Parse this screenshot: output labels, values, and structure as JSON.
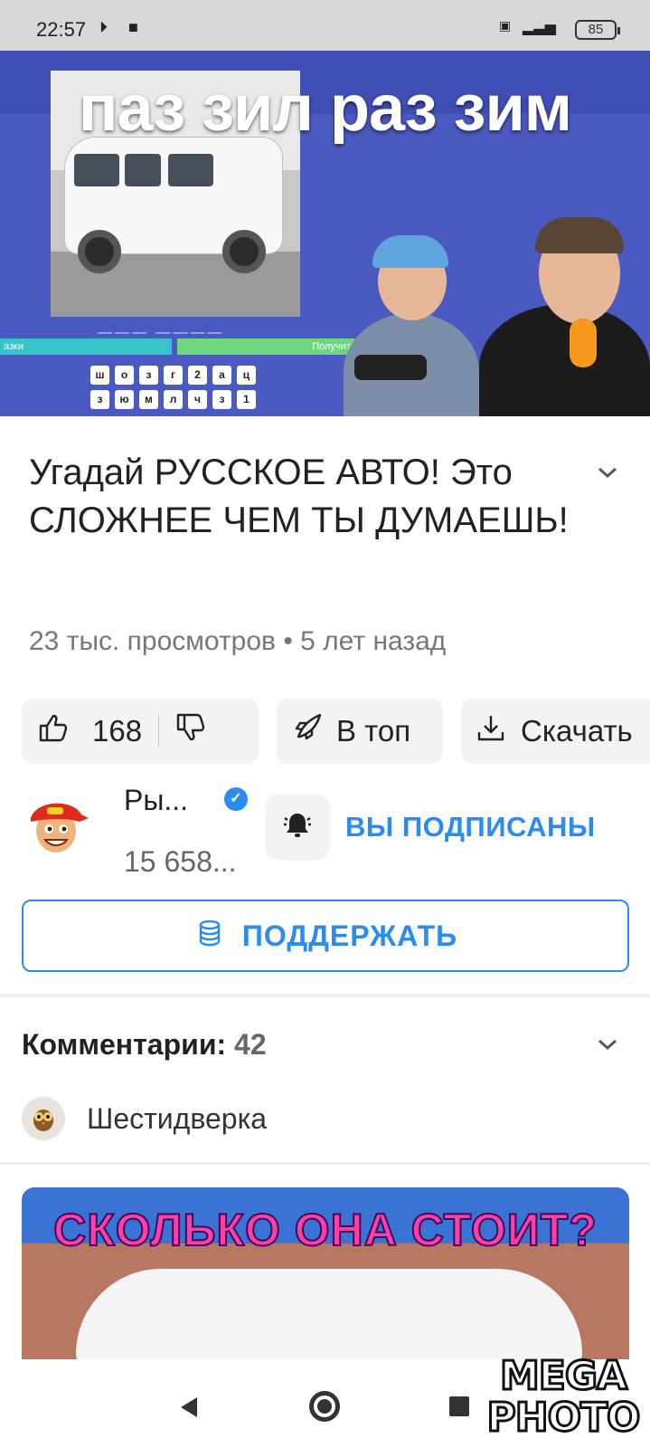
{
  "status_bar": {
    "time": "22:57",
    "battery": "85"
  },
  "video": {
    "caption": "паз зил раз зим",
    "game": {
      "bar_left": "азки",
      "bar_right": "Получит",
      "letters_row1": [
        "ш",
        "о",
        "з",
        "г",
        "2",
        "а",
        "ц"
      ],
      "letters_row2": [
        "з",
        "ю",
        "м",
        "л",
        "ч",
        "з",
        "1"
      ]
    }
  },
  "title": "Угадай РУССКОЕ АВТО! Это СЛОЖНЕЕ ЧЕМ ТЫ ДУМАЕШЬ!",
  "meta": "23 тыс. просмотров • 5 лет назад",
  "actions": {
    "like_count": "168",
    "top_label": "В топ",
    "download_label": "Скачать"
  },
  "channel": {
    "name": "Ры...",
    "subscribers": "15 658...",
    "subscribed_label": "ВЫ ПОДПИСАНЫ"
  },
  "support_label": "ПОДДЕРЖАТЬ",
  "comments": {
    "label": "Комментарии:",
    "count": "42"
  },
  "playlist_label": "Шестидверка",
  "next_video": {
    "title": "СКОЛЬКО ОНА СТОИТ?"
  },
  "watermark": {
    "line1": "MEGA",
    "line2": "PHOTO"
  },
  "colors": {
    "accent": "#2a8cf0",
    "video_bg": "#4a5ac0"
  }
}
